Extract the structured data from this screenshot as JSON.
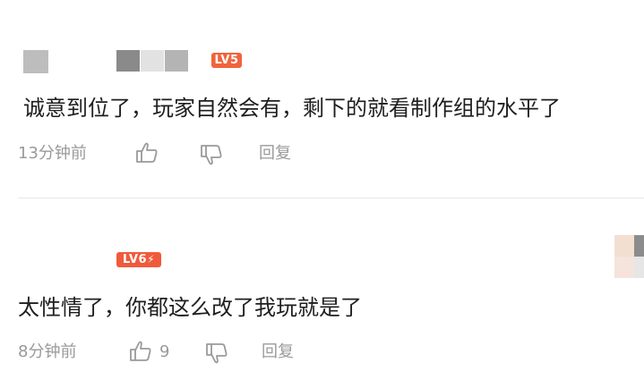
{
  "comments": [
    {
      "level_badge": "LV5",
      "text": "诚意到位了，玩家自然会有，剩下的就看制作组的水平了",
      "time": "13分钟前",
      "like_count": "",
      "reply_label": "回复"
    },
    {
      "level_badge": "LV6",
      "text": "太性情了，你都这么改了我玩就是了",
      "time": "8分钟前",
      "like_count": "9",
      "reply_label": "回复"
    }
  ],
  "colors": {
    "badge_lv5": "#f0643c",
    "badge_lv6": "#f05a3c",
    "meta_text": "#9a9a9a",
    "divider": "#e8e8e8"
  },
  "icons": {
    "like": "thumbs-up-icon",
    "dislike": "thumbs-down-icon",
    "bolt": "lightning-icon"
  }
}
